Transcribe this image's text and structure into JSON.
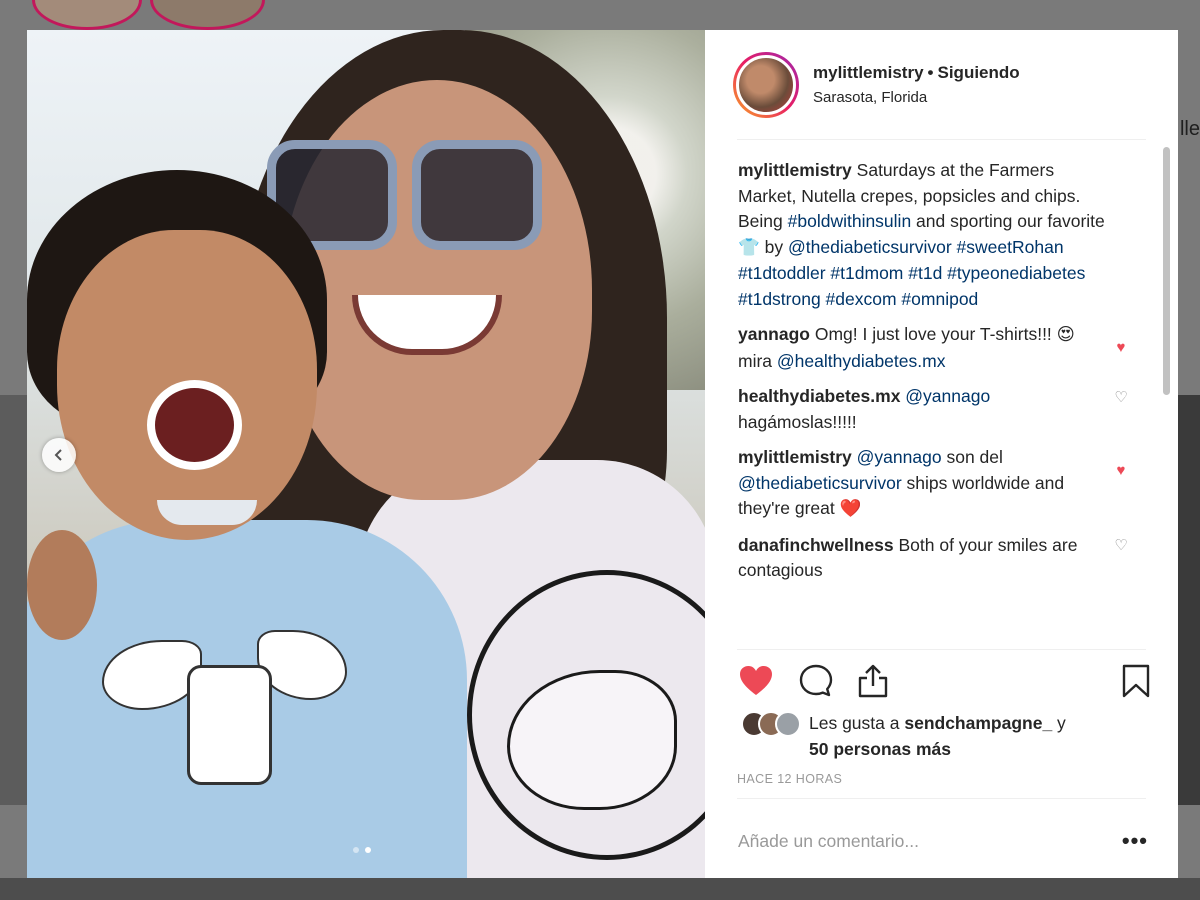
{
  "post": {
    "username": "mylittlemistry",
    "separator": "•",
    "follow_status": "Siguiendo",
    "location": "Sarasota, Florida",
    "carousel": {
      "total_slides": 2,
      "current_slide": 2
    }
  },
  "caption": {
    "username": "mylittlemistry",
    "text_1": " Saturdays at the Farmers Market, Nutella crepes, popsicles and chips. Being ",
    "tag_1": "#boldwithinsulin",
    "text_2": " and sporting our favorite ",
    "emoji": "👕",
    "text_3": " by ",
    "tags": "@thediabeticsurvivor #sweetRohan #t1dtoddler #t1dmom #t1d #typeonediabetes #t1dstrong #dexcom #omnipod"
  },
  "comments": [
    {
      "username": "yannago",
      "text": " Omg! I just love your T-shirts!!! ",
      "emoji": "😍",
      "text_after": " mira ",
      "mention": "@healthydiabetes.mx",
      "liked": true
    },
    {
      "username": "healthydiabetes.mx",
      "mention": "@yannago",
      "text": " hagámoslas!!!!!",
      "liked": false
    },
    {
      "username": "mylittlemistry",
      "mention": "@yannago",
      "text": " son del ",
      "mention2": "@thediabeticsurvivor",
      "text_after": " ships worldwide and they're great ",
      "emoji": "❤️",
      "liked": true
    },
    {
      "username": "danafinchwellness",
      "text": " Both of your smiles are contagious",
      "liked": false
    }
  ],
  "likes": {
    "prefix": "Les gusta a ",
    "user": "sendchampagne_",
    "connector": " y",
    "others": "50 personas más"
  },
  "timestamp": "HACE 12 HORAS",
  "comment_input": {
    "placeholder": "Añade un comentario..."
  },
  "more_label": "•••",
  "icons": {
    "like": "heart-filled-icon",
    "comment": "comment-bubble-icon",
    "share": "share-icon",
    "save": "bookmark-icon",
    "prev": "chevron-left-icon"
  },
  "colors": {
    "like_red": "#ed4956",
    "link_blue": "#003569",
    "muted": "#999999"
  },
  "background": {
    "partial_text": "lle"
  }
}
